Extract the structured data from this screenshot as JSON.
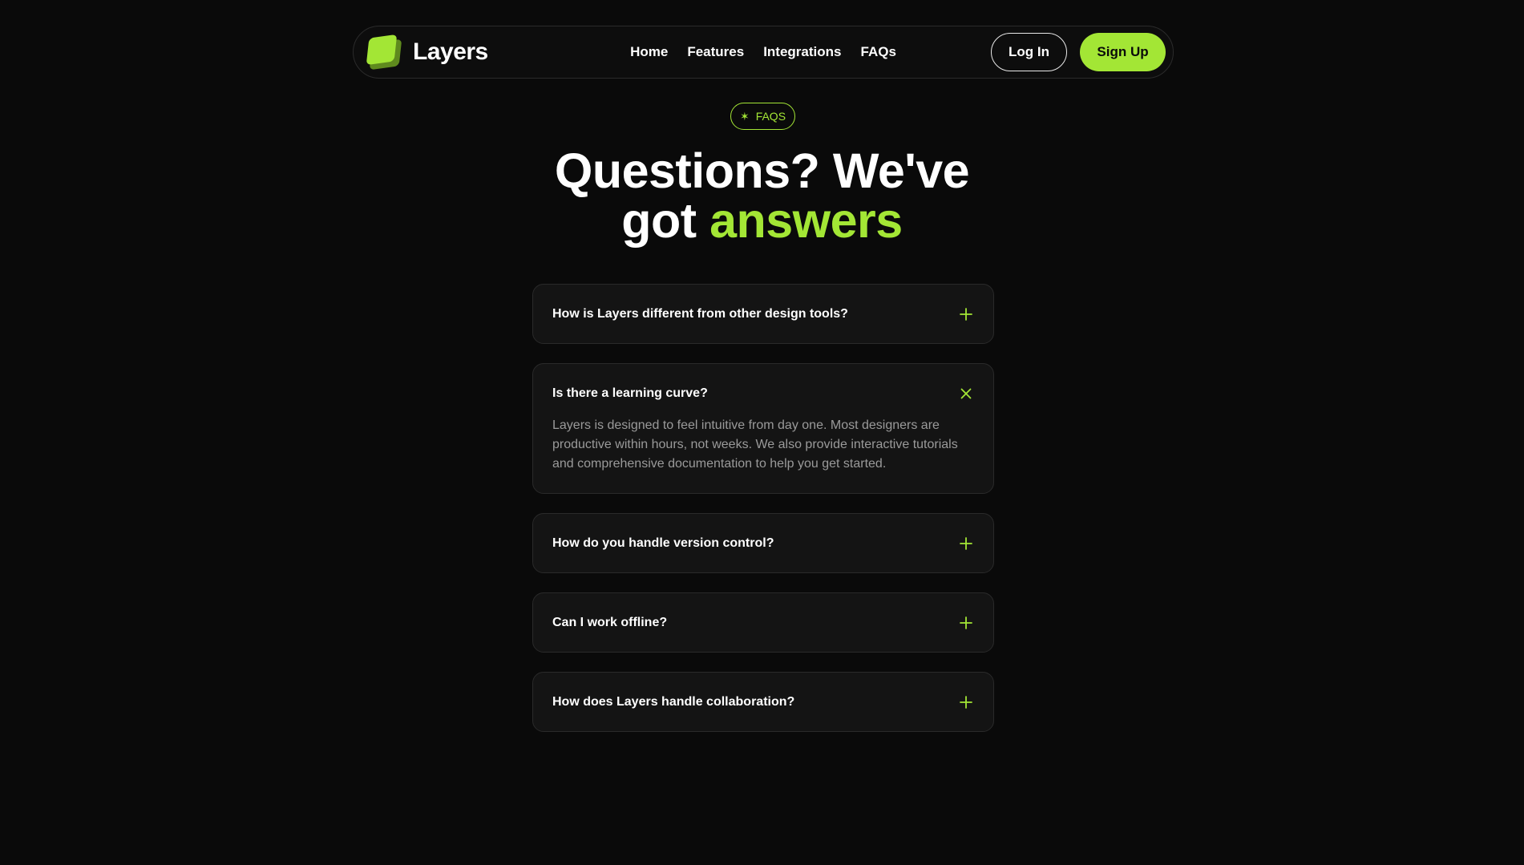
{
  "nav": {
    "brand": "Layers",
    "links": [
      "Home",
      "Features",
      "Integrations",
      "FAQs"
    ],
    "login_label": "Log In",
    "signup_label": "Sign Up"
  },
  "hero": {
    "badge": "FAQS",
    "title_line1": "Questions? We've",
    "title_line2_prefix": "got",
    "title_line2_accent": "answers"
  },
  "faqs": [
    {
      "question": "How is Layers different from other design tools?",
      "expanded": false,
      "answer": ""
    },
    {
      "question": "Is there a learning curve?",
      "expanded": true,
      "answer": "Layers is designed to feel intuitive from day one. Most designers are productive within hours, not weeks. We also provide interactive tutorials and comprehensive documentation to help you get started."
    },
    {
      "question": "How do you handle version control?",
      "expanded": false,
      "answer": ""
    },
    {
      "question": "Can I work offline?",
      "expanded": false,
      "answer": ""
    },
    {
      "question": "How does Layers handle collaboration?",
      "expanded": false,
      "answer": ""
    }
  ],
  "colors": {
    "background": "#0a0a0a",
    "accent": "#a3e635",
    "card": "#141414"
  },
  "icons": {
    "collapsed": "plus-icon",
    "expanded": "close-icon",
    "badge": "asterisk-icon"
  }
}
